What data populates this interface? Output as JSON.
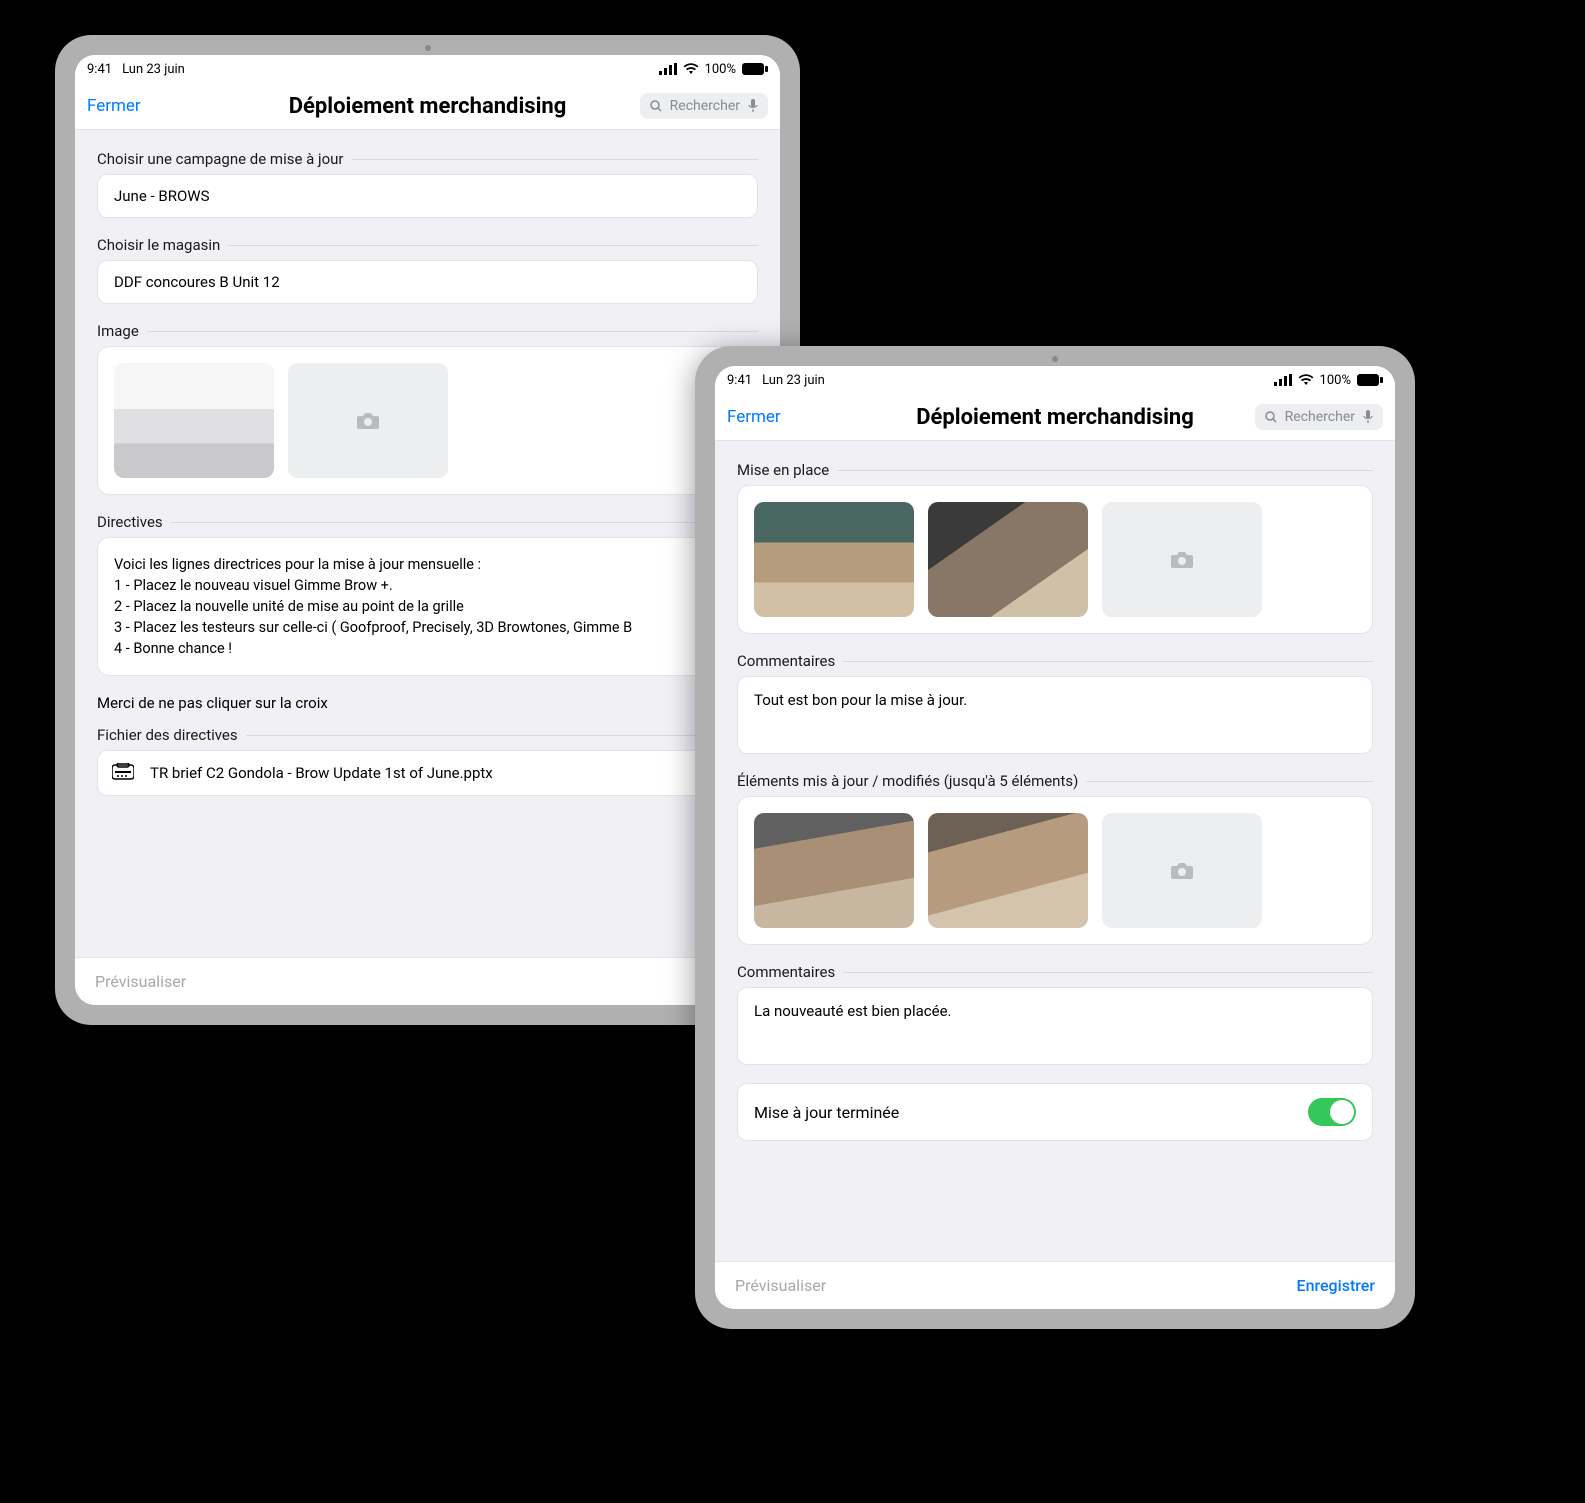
{
  "statusbar": {
    "time": "9:41",
    "date": "Lun 23 juin",
    "battery": "100%"
  },
  "navbar": {
    "close": "Fermer",
    "title": "Déploiement merchandising",
    "search_placeholder": "Rechercher"
  },
  "footer": {
    "preview": "Prévisualiser",
    "save": "Enregistrer"
  },
  "tablet1": {
    "campaign_label": "Choisir une campagne de mise à jour",
    "campaign_value": "June - BROWS",
    "store_label": "Choisir le magasin",
    "store_value": "DDF concoures B Unit 12",
    "image_label": "Image",
    "directives_label": "Directives",
    "directives_text": "Voici les lignes directrices pour la mise à jour mensuelle :\n1 - Placez le nouveau visuel Gimme Brow +.\n2 - Placez la nouvelle unité de mise au point de la grille\n3 - Placez les testeurs sur celle-ci ( Goofproof, Precisely, 3D Browtones, Gimme B\n4 - Bonne chance !",
    "cross_note": "Merci de ne pas cliquer sur la croix",
    "file_label": "Fichier des directives",
    "file_name": "TR brief C2 Gondola - Brow Update 1st of June.pptx"
  },
  "tablet2": {
    "setup_label": "Mise en place",
    "comments_label": "Commentaires",
    "comment1": "Tout est bon pour la mise à jour.",
    "modified_label": "Éléments mis à jour / modifiés (jusqu'à 5 éléments)",
    "comment2": "La nouveauté est bien placée.",
    "done_label": "Mise à jour terminée"
  }
}
